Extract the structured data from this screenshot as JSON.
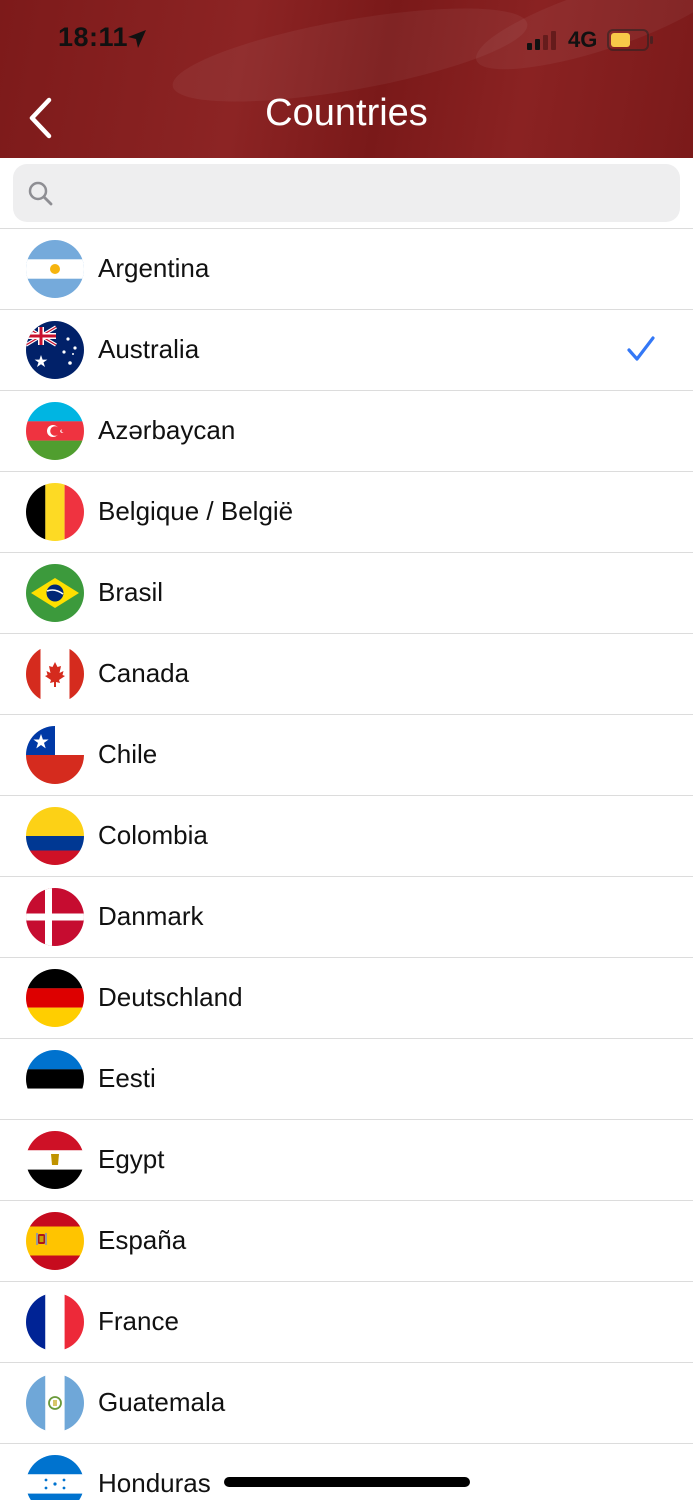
{
  "status_bar": {
    "time": "18:11",
    "network": "4G",
    "battery_color": "#f7c948"
  },
  "nav": {
    "title": "Countries"
  },
  "search": {
    "placeholder": "",
    "value": ""
  },
  "colors": {
    "header": "#821e1e",
    "accent": "#3478f6",
    "separator": "#dcdcdc"
  },
  "countries": [
    {
      "label": "Argentina",
      "flag": "argentina-flag-icon",
      "selected": false
    },
    {
      "label": "Australia",
      "flag": "australia-flag-icon",
      "selected": true
    },
    {
      "label": "Azərbaycan",
      "flag": "azerbaijan-flag-icon",
      "selected": false
    },
    {
      "label": "Belgique / België",
      "flag": "belgium-flag-icon",
      "selected": false
    },
    {
      "label": "Brasil",
      "flag": "brazil-flag-icon",
      "selected": false
    },
    {
      "label": "Canada",
      "flag": "canada-flag-icon",
      "selected": false
    },
    {
      "label": "Chile",
      "flag": "chile-flag-icon",
      "selected": false
    },
    {
      "label": "Colombia",
      "flag": "colombia-flag-icon",
      "selected": false
    },
    {
      "label": "Danmark",
      "flag": "denmark-flag-icon",
      "selected": false
    },
    {
      "label": "Deutschland",
      "flag": "germany-flag-icon",
      "selected": false
    },
    {
      "label": "Eesti",
      "flag": "estonia-flag-icon",
      "selected": false
    },
    {
      "label": "Egypt",
      "flag": "egypt-flag-icon",
      "selected": false
    },
    {
      "label": "España",
      "flag": "spain-flag-icon",
      "selected": false
    },
    {
      "label": "France",
      "flag": "france-flag-icon",
      "selected": false
    },
    {
      "label": "Guatemala",
      "flag": "guatemala-flag-icon",
      "selected": false
    },
    {
      "label": "Honduras",
      "flag": "honduras-flag-icon",
      "selected": false
    }
  ]
}
